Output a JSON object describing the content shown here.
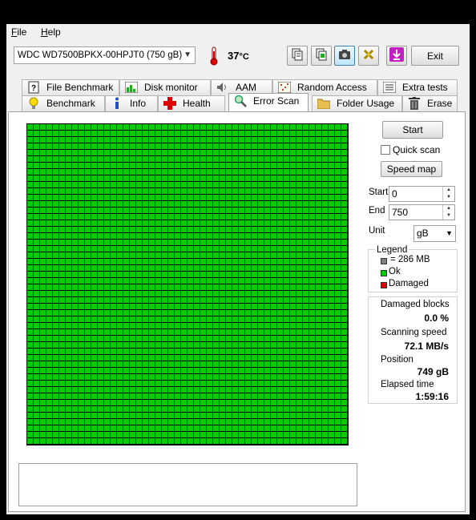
{
  "menu": {
    "file": "File",
    "file_key": "F",
    "file_rest": "ile",
    "help_key": "H",
    "help_rest": "elp"
  },
  "toolbar": {
    "drive": "WDC WD7500BPKX-00HPJT0 (750 gB)",
    "temperature": "37",
    "temperature_unit": "°C",
    "exit_label": "Exit",
    "icons": [
      "copy-text-icon",
      "copy-all-icon",
      "screenshot-icon",
      "options-icon",
      "save-down-icon"
    ]
  },
  "tabs_row1": [
    {
      "label": "File Benchmark",
      "icon": "file-benchmark-icon"
    },
    {
      "label": "Disk monitor",
      "icon": "disk-monitor-icon"
    },
    {
      "label": "AAM",
      "icon": "speaker-icon"
    },
    {
      "label": "Random Access",
      "icon": "random-access-icon"
    },
    {
      "label": "Extra tests",
      "icon": "extra-tests-icon"
    }
  ],
  "tabs_row2": [
    {
      "label": "Benchmark",
      "icon": "lightbulb-icon"
    },
    {
      "label": "Info",
      "icon": "info-icon"
    },
    {
      "label": "Health",
      "icon": "health-cross-icon"
    },
    {
      "label": "Error Scan",
      "icon": "magnifier-icon",
      "active": true
    },
    {
      "label": "Folder Usage",
      "icon": "folder-icon"
    },
    {
      "label": "Erase",
      "icon": "trash-icon"
    }
  ],
  "scan": {
    "start_button": "Start",
    "quick_scan_label": "Quick scan",
    "quick_scan_checked": false,
    "speed_map_button": "Speed map",
    "start_label": "Start",
    "start_value": "0",
    "end_label": "End",
    "end_value": "750",
    "unit_label": "Unit",
    "unit_value": "gB"
  },
  "legend": {
    "title": "Legend",
    "items": [
      {
        "label": "= 286 MB",
        "color": "#808080"
      },
      {
        "label": "Ok",
        "color": "#00cc00"
      },
      {
        "label": "Damaged",
        "color": "#dd0000"
      }
    ]
  },
  "stats": {
    "damaged_blocks_label": "Damaged blocks",
    "damaged_blocks_value": "0.0 %",
    "scanning_speed_label": "Scanning speed",
    "scanning_speed_value": "72.1 MB/s",
    "position_label": "Position",
    "position_value": "749 gB",
    "elapsed_time_label": "Elapsed time",
    "elapsed_time_value": "1:59:16"
  },
  "grid": {
    "columns": 50,
    "rows": 50,
    "ok_fraction": 1.0,
    "ok_color": "#00cc00"
  },
  "log": {
    "text": ""
  }
}
